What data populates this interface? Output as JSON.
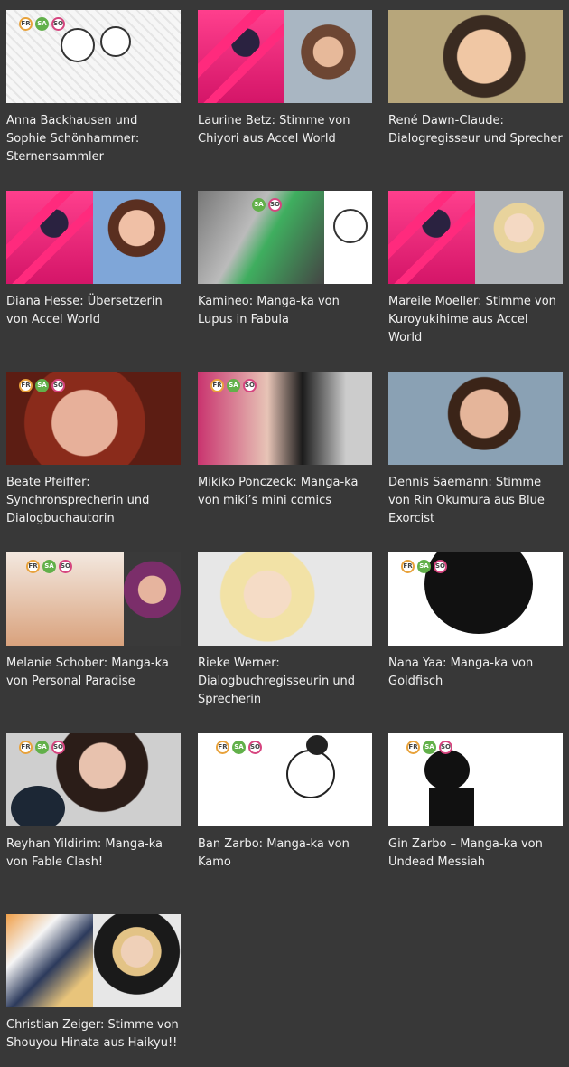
{
  "badges": [
    "FR",
    "SA",
    "SO"
  ],
  "cards": [
    {
      "caption": "Anna Backhausen und Sophie Schönhammer: Sternensammler"
    },
    {
      "caption": "Laurine Betz: Stimme von Chiyori aus Accel World"
    },
    {
      "caption": "René Dawn-Claude: Dialogregisseur und Sprecher"
    },
    {
      "caption": "Diana Hesse: Übersetzerin von Accel World"
    },
    {
      "caption": "Kamineo: Manga-ka von Lupus in Fabula"
    },
    {
      "caption": "Mareile Moeller: Stimme von Kuroyukihime aus Accel World"
    },
    {
      "caption": "Beate Pfeiffer: Synchronsprecherin und Dialogbuchautorin"
    },
    {
      "caption": "Mikiko Ponczeck: Manga-ka von miki’s mini comics"
    },
    {
      "caption": "Dennis Saemann: Stimme von Rin Okumura aus Blue Exorcist"
    },
    {
      "caption": "Melanie Schober: Manga-ka von Personal Paradise"
    },
    {
      "caption": "Rieke Werner: Dialogbuchregisseurin und Sprecherin"
    },
    {
      "caption": "Nana Yaa: Manga-ka von Goldfisch"
    },
    {
      "caption": "Reyhan Yildirim: Manga-ka von Fable Clash!"
    },
    {
      "caption": "Ban Zarbo: Manga-ka von Kamo"
    },
    {
      "caption": "Gin Zarbo – Manga-ka von Undead Messiah"
    },
    {
      "caption": "Christian Zeiger: Stimme von Shouyou Hinata aus Haikyu!!"
    }
  ]
}
